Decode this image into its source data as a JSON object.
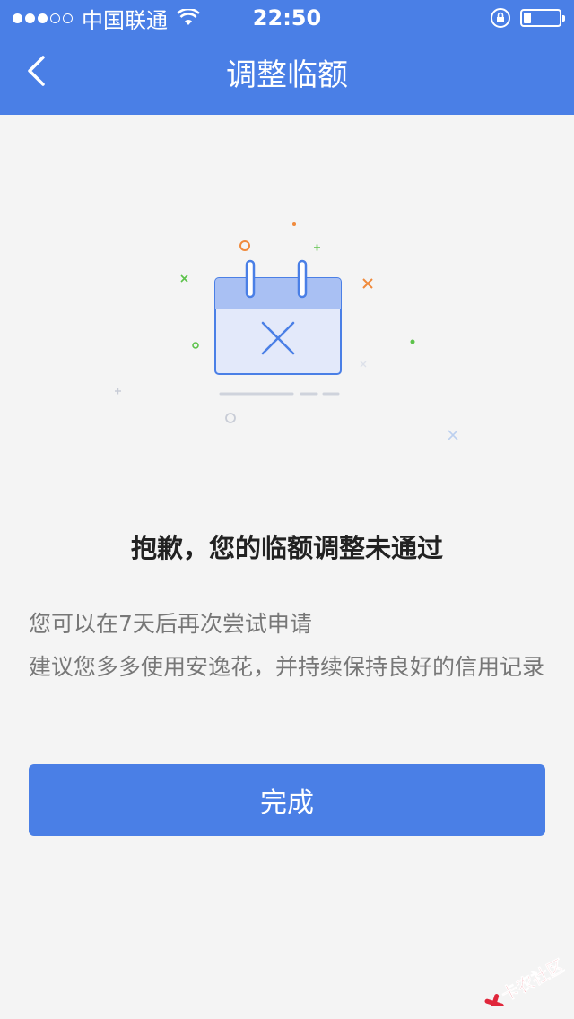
{
  "status_bar": {
    "carrier": "中国联通",
    "time": "22:50",
    "signal_bars_filled": 3,
    "signal_bars_total": 5,
    "battery_level": 0.2,
    "icons": [
      "wifi-icon",
      "rotation-lock-icon",
      "battery-icon"
    ]
  },
  "nav": {
    "title": "调整临额",
    "back_icon": "chevron-left-icon"
  },
  "illustration": {
    "icon": "calendar-reject-icon",
    "accent_color": "#4a7fe6"
  },
  "result": {
    "title": "抱歉，您的临额调整未通过",
    "line1": "您可以在7天后再次尝试申请",
    "line2": "建议您多多使用安逸花，并持续保持良好的信用记录"
  },
  "actions": {
    "done_label": "完成"
  },
  "watermark": {
    "text": "卡农社区"
  },
  "colors": {
    "primary": "#4a7fe6",
    "background": "#f4f4f4",
    "title_text": "#222222",
    "body_text": "#777777"
  }
}
